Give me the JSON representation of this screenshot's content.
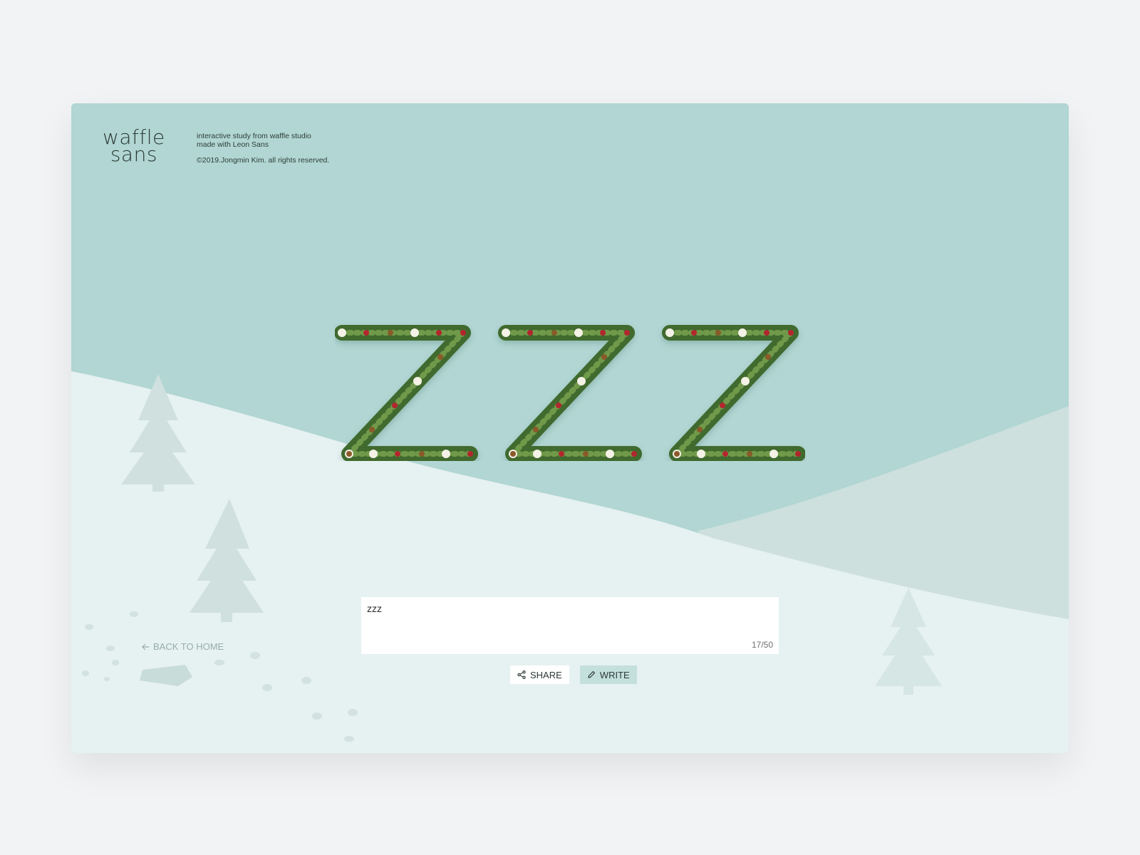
{
  "brand": {
    "logo_line1": "waffle",
    "logo_line2": "sans"
  },
  "credits": {
    "line1": "interactive study from waffle studio",
    "line2": "made with Leon Sans",
    "copyright": "©2019.Jongmin Kim. all rights reserved."
  },
  "display": {
    "text": "zzz"
  },
  "editor": {
    "value": "zzz",
    "counter": "17/50"
  },
  "actions": {
    "share_label": "SHARE",
    "share_icon": "share-icon",
    "write_label": "WRITE",
    "write_icon": "pencil-icon"
  },
  "nav": {
    "back_label": "BACK TO HOME",
    "back_icon": "arrow-left-icon"
  },
  "colors": {
    "sky": "#b1d6d3",
    "snow": "#e6f1f1",
    "far_hill": "#cde0dd",
    "tree": "#cfe0de",
    "garland": "#3f6a2f",
    "berry": "#b2262d",
    "write_button_bg": "#c4e0dc"
  }
}
